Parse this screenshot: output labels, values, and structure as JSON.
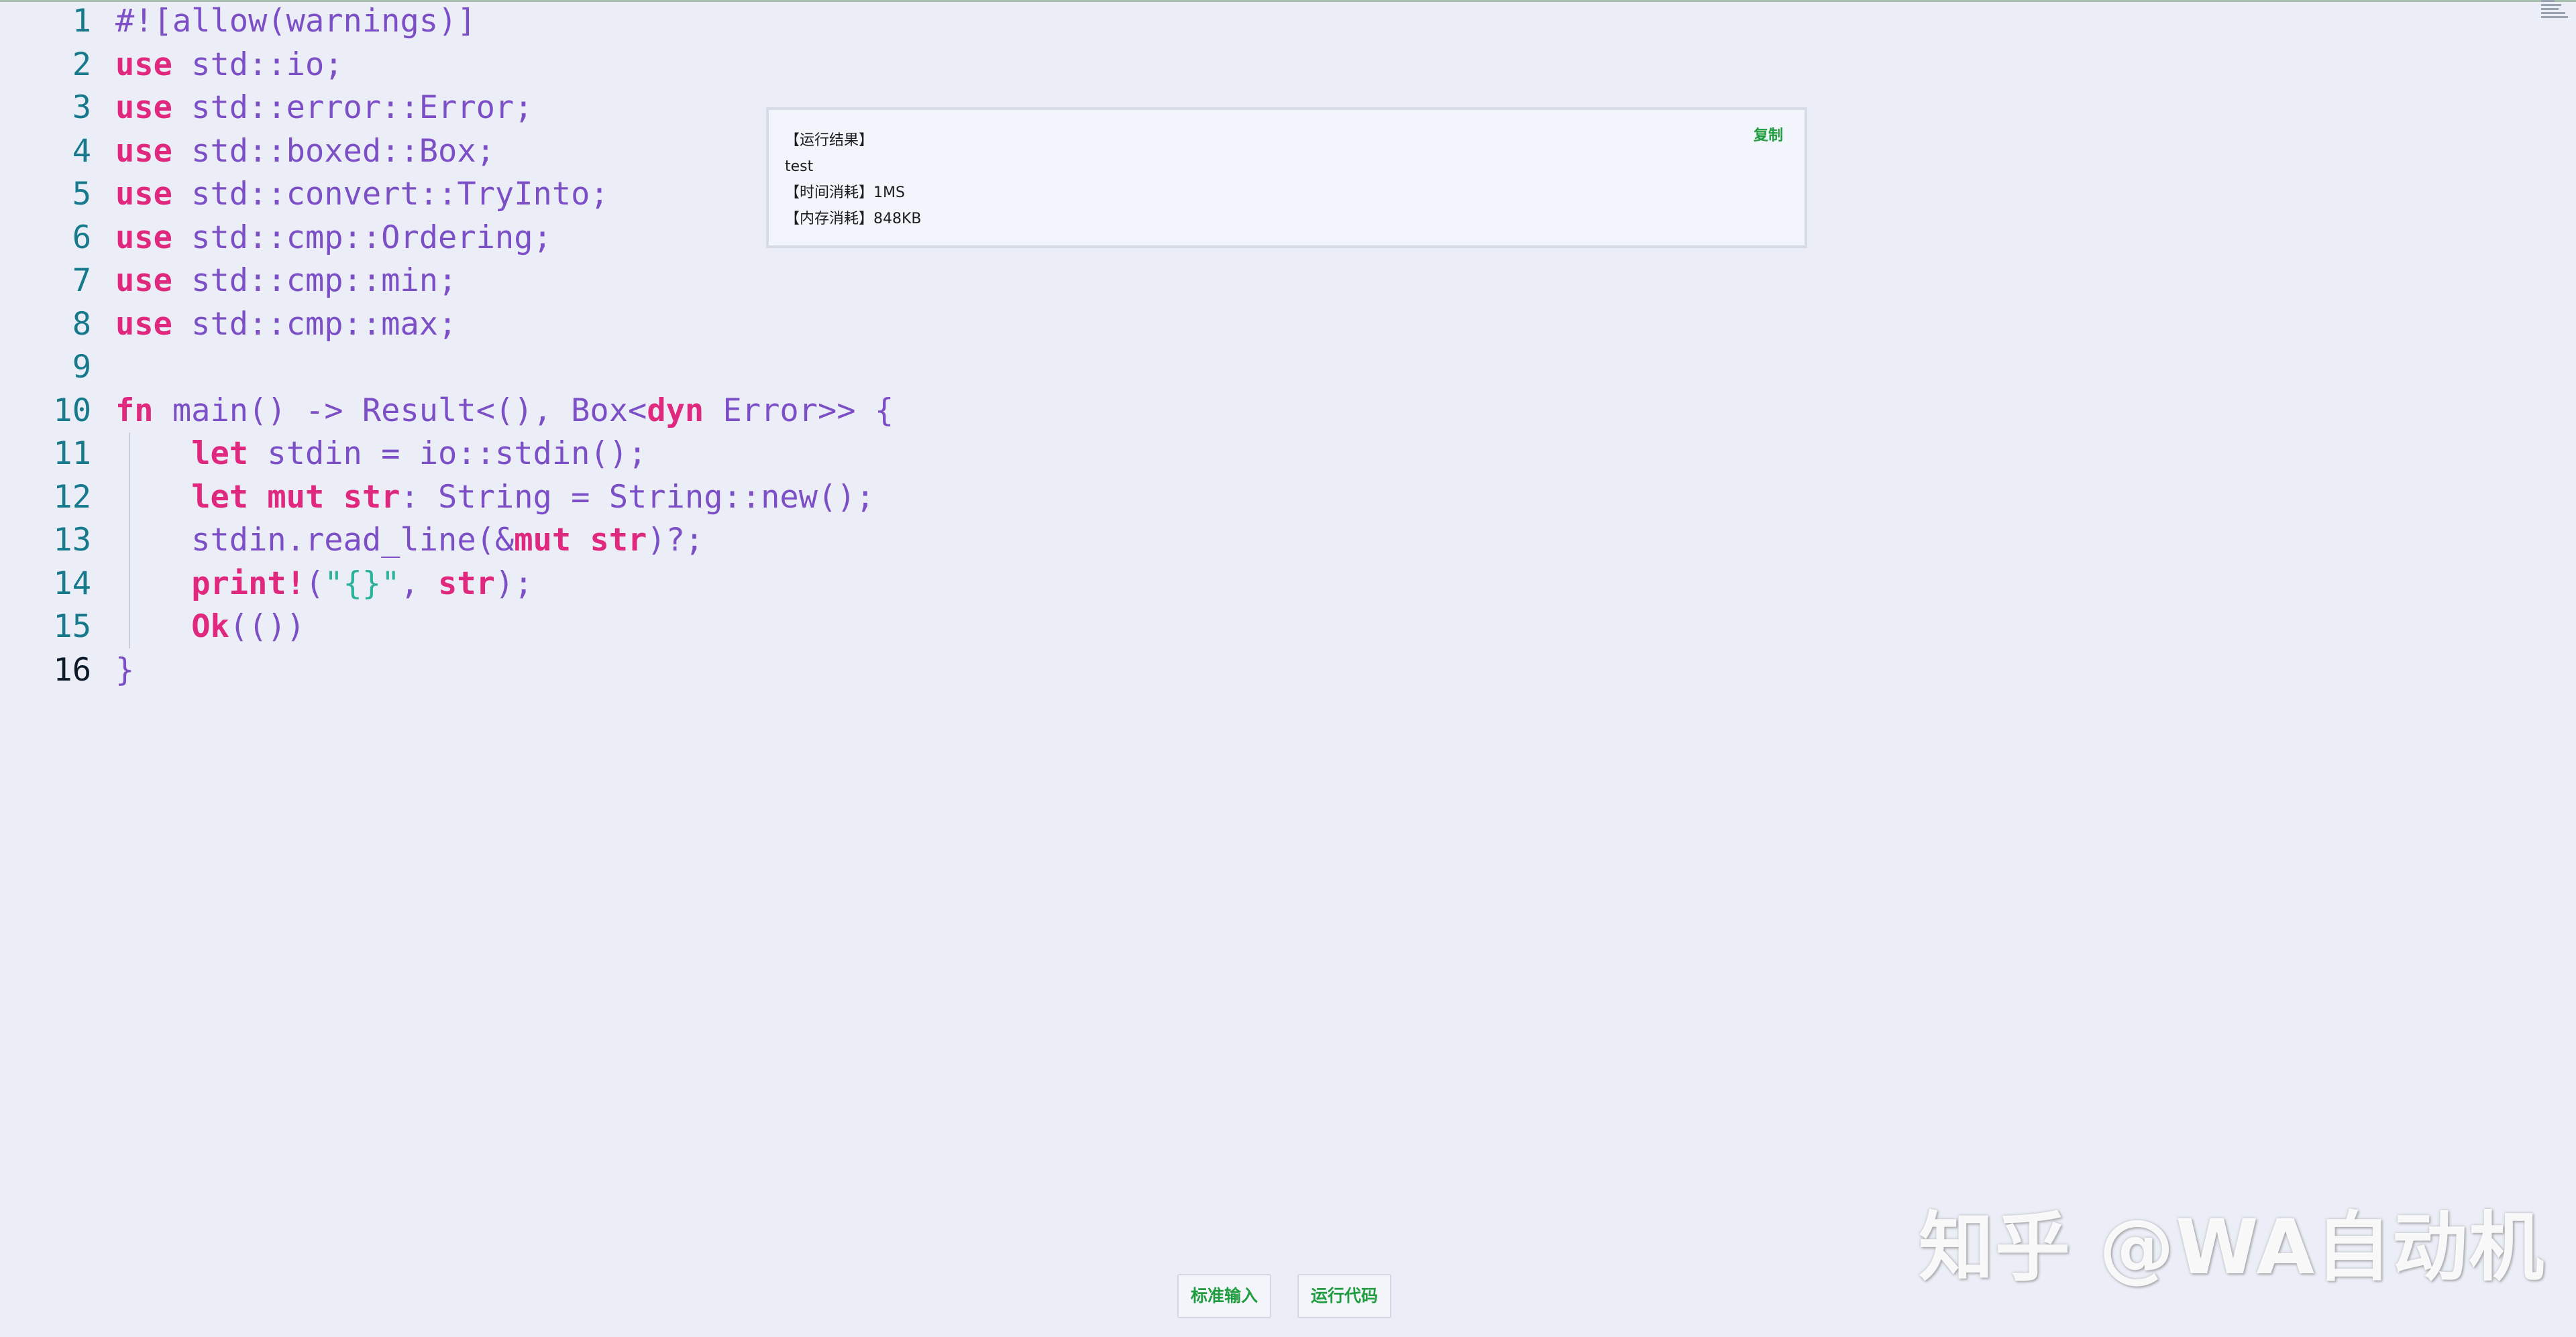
{
  "editor": {
    "lines": [
      {
        "n": "1",
        "html": "#![allow(warnings)]"
      },
      {
        "n": "2",
        "html": "<span class='kw'>use</span> std::io;"
      },
      {
        "n": "3",
        "html": "<span class='kw'>use</span> std::error::Error;"
      },
      {
        "n": "4",
        "html": "<span class='kw'>use</span> std::boxed::Box;"
      },
      {
        "n": "5",
        "html": "<span class='kw'>use</span> std::convert::TryInto;"
      },
      {
        "n": "6",
        "html": "<span class='kw'>use</span> std::cmp::Ordering;"
      },
      {
        "n": "7",
        "html": "<span class='kw'>use</span> std::cmp::min;"
      },
      {
        "n": "8",
        "html": "<span class='kw'>use</span> std::cmp::max;"
      },
      {
        "n": "9",
        "html": ""
      },
      {
        "n": "10",
        "html": "<span class='kw'>fn</span> main() -> Result<(), Box<<span class='kw'>dyn</span> Error>> {"
      },
      {
        "n": "11",
        "html": "    <span class='kw'>let</span> stdin = io::stdin();"
      },
      {
        "n": "12",
        "html": "    <span class='kw'>let</span> <span class='kw'>mut</span> <span class='kw'>str</span>: String = String::new();"
      },
      {
        "n": "13",
        "html": "    stdin.read_line(&<span class='kw'>mut</span> <span class='kw'>str</span>)?;"
      },
      {
        "n": "14",
        "html": "    <span class='fnm'>print!</span>(<span class='str'>\"{}\"</span>, <span class='kw'>str</span>);"
      },
      {
        "n": "15",
        "html": "    <span class='fnm'>Ok</span>(())"
      },
      {
        "n": "16",
        "html": "}"
      }
    ],
    "current_line": "16"
  },
  "result": {
    "header": "【运行结果】",
    "output": "test",
    "time": "【时间消耗】1MS",
    "memory": "【内存消耗】848KB",
    "copy_label": "复制"
  },
  "buttons": {
    "stdin_label": "标准输入",
    "run_label": "运行代码"
  },
  "watermark": "知乎 @WA自动机"
}
